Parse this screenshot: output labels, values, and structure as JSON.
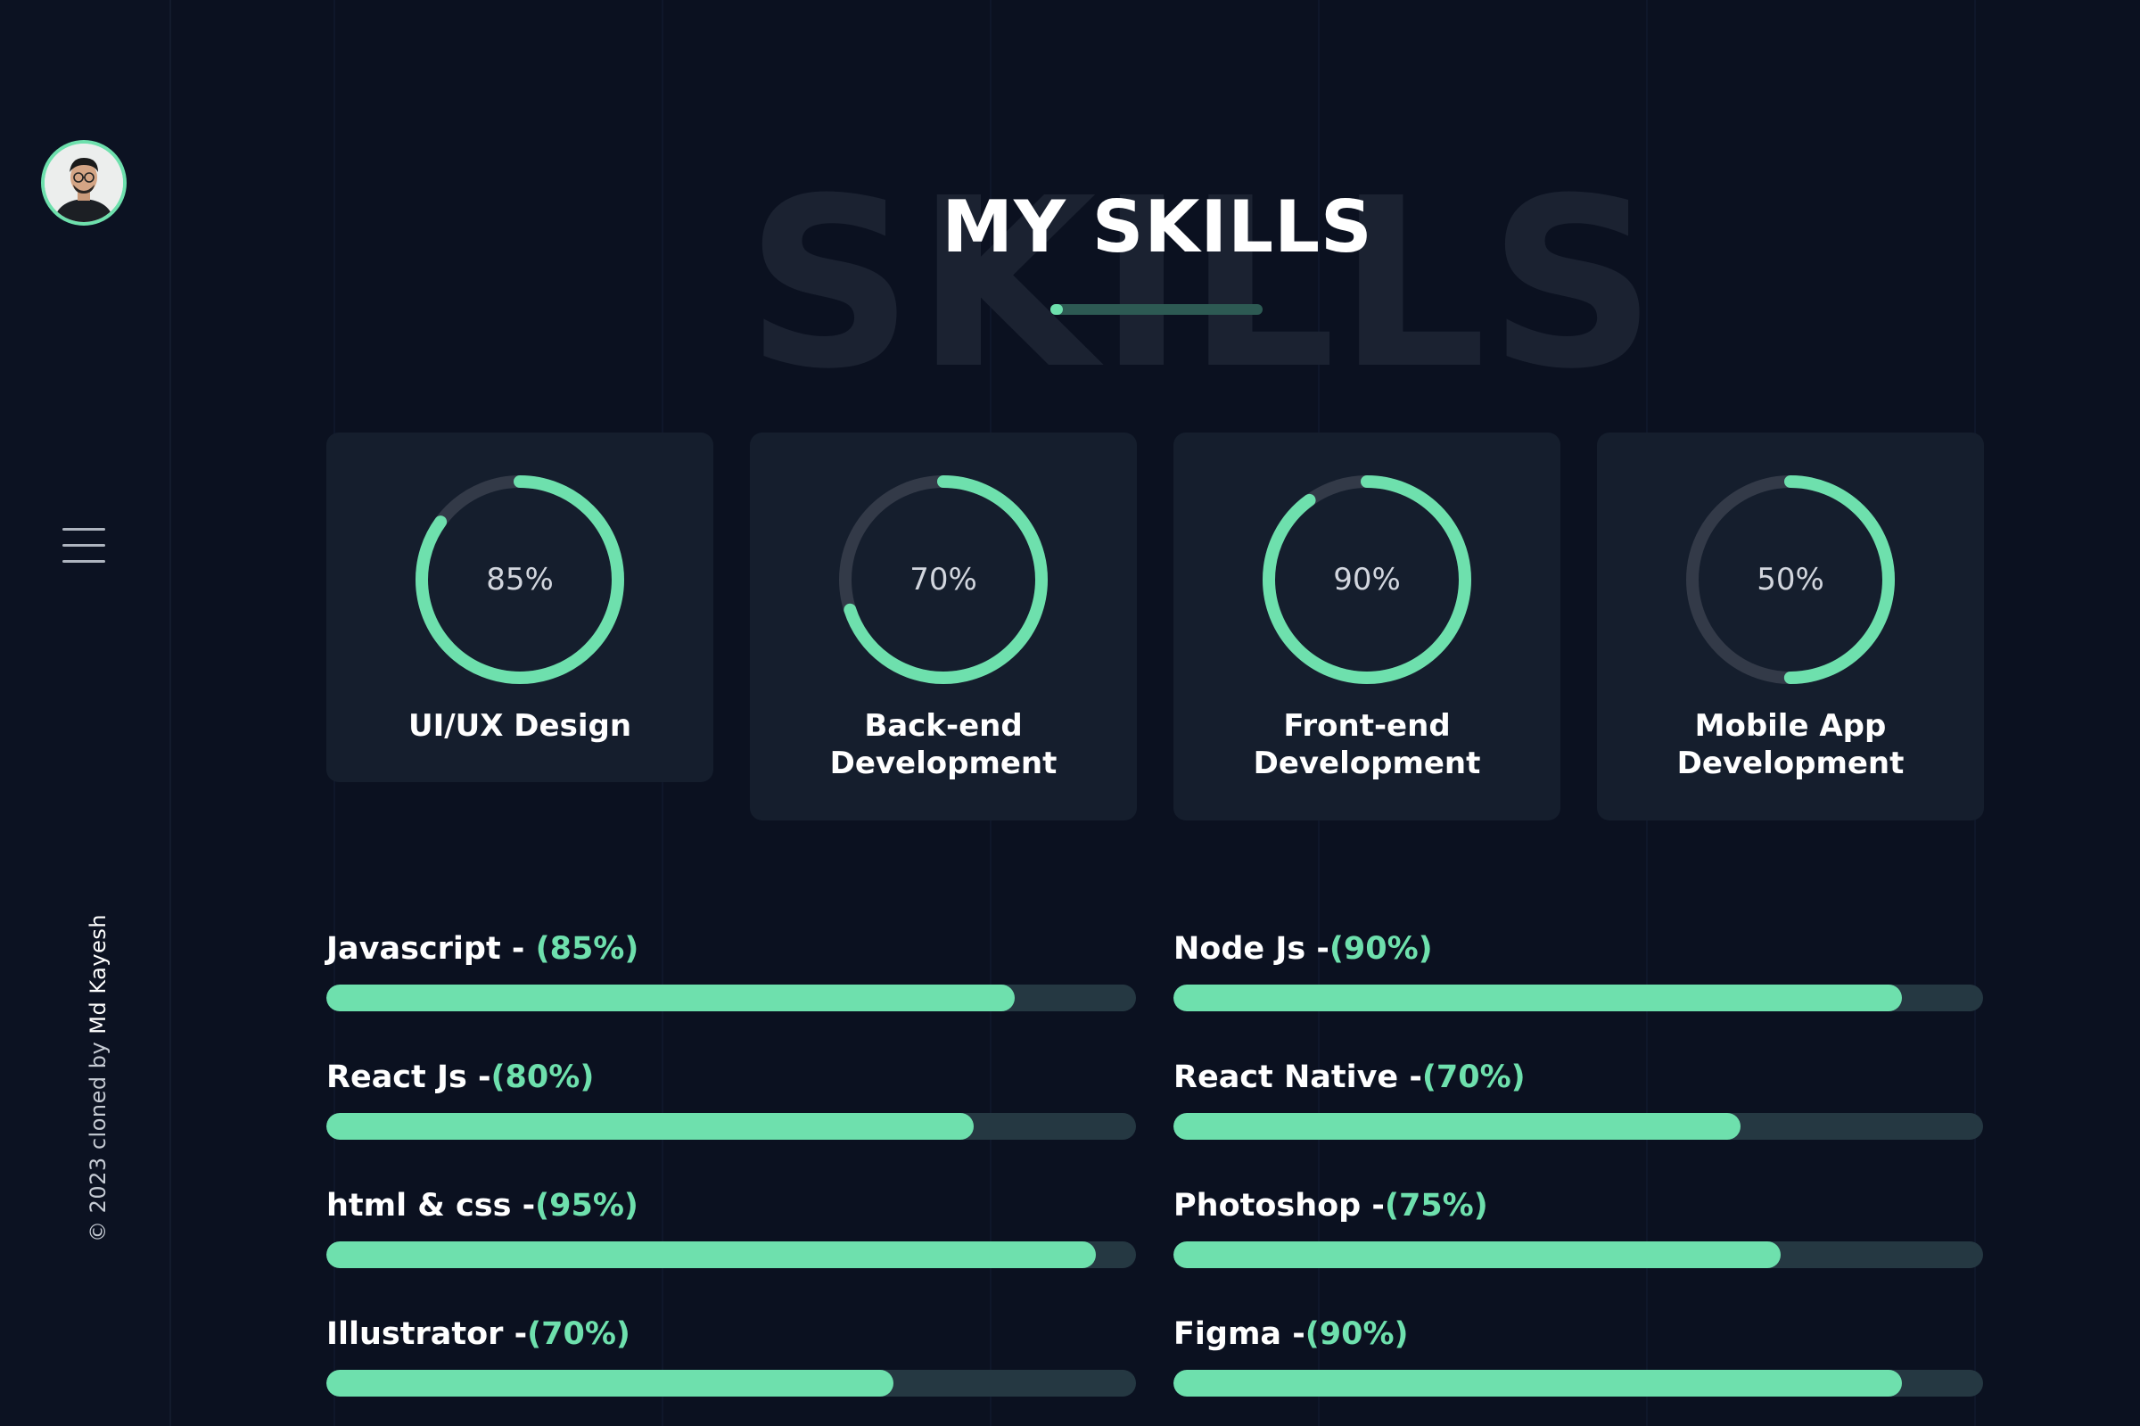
{
  "sidebar": {
    "copyright_prefix": "© 2023 cloned by ",
    "copyright_name": "Md Kayesh"
  },
  "header": {
    "title": "MY SKILLS",
    "background_word": "SKILLS"
  },
  "cards": [
    {
      "percent": 85,
      "percent_label": "85%",
      "title_lines": [
        "UI/UX Design"
      ]
    },
    {
      "percent": 70,
      "percent_label": "70%",
      "title_lines": [
        "Back-end",
        "Development"
      ]
    },
    {
      "percent": 90,
      "percent_label": "90%",
      "title_lines": [
        "Front-end",
        "Development"
      ]
    },
    {
      "percent": 50,
      "percent_label": "50%",
      "title_lines": [
        "Mobile App",
        "Development"
      ]
    }
  ],
  "skills_left": [
    {
      "name": "Javascript - ",
      "pct_label": "(85%)",
      "value": 85
    },
    {
      "name": "React Js -",
      "pct_label": "(80%)",
      "value": 80
    },
    {
      "name": "html & css -",
      "pct_label": "(95%)",
      "value": 95
    },
    {
      "name": "Illustrator -",
      "pct_label": "(70%)",
      "value": 70
    }
  ],
  "skills_right": [
    {
      "name": "Node Js -",
      "pct_label": "(90%)",
      "value": 90
    },
    {
      "name": "React Native -",
      "pct_label": "(70%)",
      "value": 70
    },
    {
      "name": "Photoshop -",
      "pct_label": "(75%)",
      "value": 75
    },
    {
      "name": "Figma -",
      "pct_label": "(90%)",
      "value": 90
    }
  ],
  "colors": {
    "accent": "#6ee0ad",
    "background": "#0b1120",
    "card": "#151e2d",
    "track": "#253842",
    "ring_track": "#333a48"
  }
}
